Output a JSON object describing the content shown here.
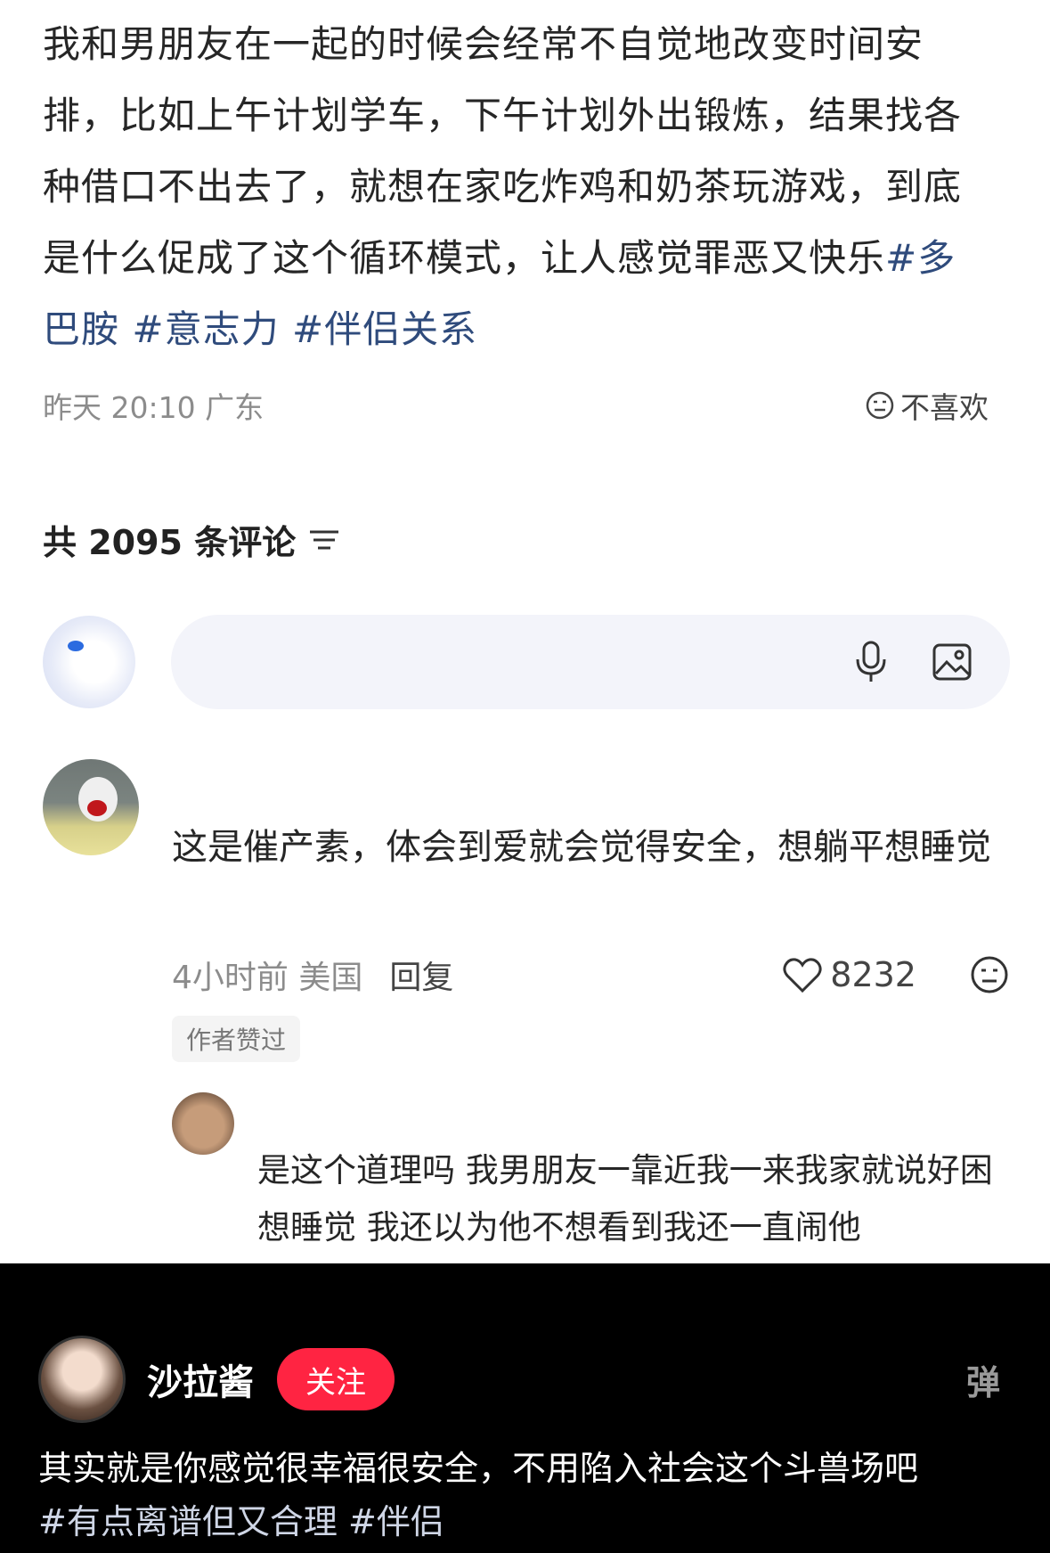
{
  "post": {
    "body": "我和男朋友在一起的时候会经常不自觉地改变时间安排，比如上午计划学车，下午计划外出锻炼，结果找各种借口不出去了，就想在家吃炸鸡和奶茶玩游戏，到底是什么促成了这个循环模式，让人感觉罪恶又快乐",
    "tags": [
      "#多巴胺",
      "#意志力",
      "#伴侣关系"
    ],
    "time": "昨天 20:10",
    "location": "广东",
    "dislike_label": "不喜欢"
  },
  "comments_header": {
    "label": "共 2095 条评论"
  },
  "composer": {
    "placeholder": ""
  },
  "comment": {
    "text": "这是催产素，体会到爱就会觉得安全，想躺平想睡觉",
    "time": "4小时前",
    "location": "美国",
    "reply_label": "回复",
    "likes": "8232",
    "badge": "作者赞过"
  },
  "reply": {
    "text": "是这个道理吗 我男朋友一靠近我一来我家就说好困想睡觉 我还以为他不想看到我还一直闹他"
  },
  "overlay": {
    "username": "沙拉酱",
    "follow_label": "关注",
    "danmaku_label": "弹",
    "text": "其实就是你感觉很幸福很安全，不用陷入社会这个斗兽场吧",
    "tags": [
      "#有点离谱但又合理",
      "#伴侣"
    ]
  },
  "colors": {
    "tag": "#2f4b7c",
    "follow": "#ff2442",
    "overlay_bg": "#000000"
  }
}
